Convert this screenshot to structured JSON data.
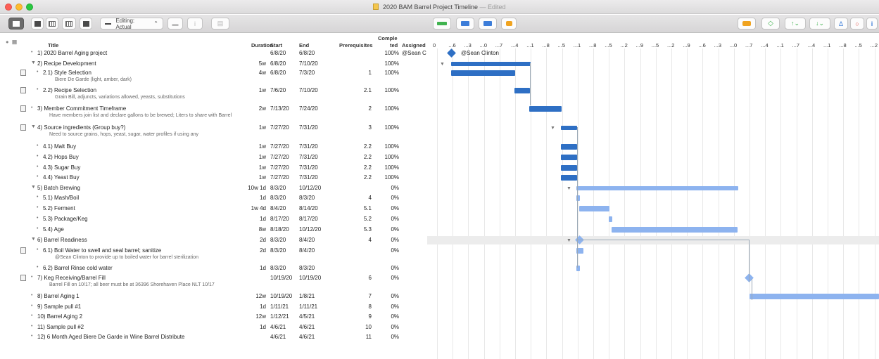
{
  "window": {
    "title": "2020 BAM Barrel Project Timeline",
    "status": "— Edited"
  },
  "toolbar": {
    "editing_label": "Editing: Actual",
    "editing_chevron": "⌃"
  },
  "columns": {
    "title": "Title",
    "duration": "Duration",
    "start": "Start",
    "end": "End",
    "prereq": "Prerequisites",
    "completed_1": "Comple",
    "completed_2": "ted",
    "assigned": "Assigned"
  },
  "gantt_header": [
    "0",
    "...6",
    "...3",
    "...0",
    "...7",
    "...4",
    "...1",
    "...8",
    "...5",
    "...1",
    "...8",
    "...5",
    "...2",
    "...9",
    "...5",
    "...2",
    "...9",
    "...6",
    "...3",
    "...0",
    "...7",
    "...4",
    "...1",
    "...7",
    "...4",
    "...1",
    "...8",
    "...5",
    "...2"
  ],
  "rows": [
    {
      "bullet": "•",
      "title": "1) 2020 Barrel Aging project",
      "duration": "",
      "start": "6/8/20",
      "end": "6/8/20",
      "prereq": "",
      "pct": "100%",
      "assigned": "@Sean C",
      "note": ""
    },
    {
      "bullet": "▼",
      "title": "2) Recipe Development",
      "duration": "5w",
      "start": "6/8/20",
      "end": "7/10/20",
      "prereq": "",
      "pct": "100%",
      "assigned": "",
      "note": ""
    },
    {
      "bullet": "•",
      "title": "2.1) Style Selection",
      "duration": "4w",
      "start": "6/8/20",
      "end": "7/3/20",
      "prereq": "1",
      "pct": "100%",
      "assigned": "",
      "note": "Biere De Garde (light, amber, dark)"
    },
    {
      "bullet": "•",
      "title": "2.2) Recipe Selection",
      "duration": "1w",
      "start": "7/6/20",
      "end": "7/10/20",
      "prereq": "2.1",
      "pct": "100%",
      "assigned": "",
      "note": "Grain Bill, adjuncts, variations allowed, yeasts, substitutions"
    },
    {
      "bullet": "•",
      "title": "3) Member Commitment Timeframe",
      "duration": "2w",
      "start": "7/13/20",
      "end": "7/24/20",
      "prereq": "2",
      "pct": "100%",
      "assigned": "",
      "note": "Have members join list and declare gallons to be brewed; Liters to share with Barrel"
    },
    {
      "bullet": "▼",
      "title": "4) Source ingredients (Group buy?)",
      "duration": "1w",
      "start": "7/27/20",
      "end": "7/31/20",
      "prereq": "3",
      "pct": "100%",
      "assigned": "",
      "note": "Need to source grains, hops, yeast, sugar, water profiles if using any"
    },
    {
      "bullet": "•",
      "title": "4.1) Malt Buy",
      "duration": "1w",
      "start": "7/27/20",
      "end": "7/31/20",
      "prereq": "2.2",
      "pct": "100%",
      "assigned": "",
      "note": ""
    },
    {
      "bullet": "•",
      "title": "4.2) Hops Buy",
      "duration": "1w",
      "start": "7/27/20",
      "end": "7/31/20",
      "prereq": "2.2",
      "pct": "100%",
      "assigned": "",
      "note": ""
    },
    {
      "bullet": "•",
      "title": "4.3) Sugar Buy",
      "duration": "1w",
      "start": "7/27/20",
      "end": "7/31/20",
      "prereq": "2.2",
      "pct": "100%",
      "assigned": "",
      "note": ""
    },
    {
      "bullet": "•",
      "title": "4.4) Yeast Buy",
      "duration": "1w",
      "start": "7/27/20",
      "end": "7/31/20",
      "prereq": "2.2",
      "pct": "100%",
      "assigned": "",
      "note": ""
    },
    {
      "bullet": "▼",
      "title": "5) Batch Brewing",
      "duration": "10w 1d",
      "start": "8/3/20",
      "end": "10/12/20",
      "prereq": "",
      "pct": "0%",
      "assigned": "",
      "note": ""
    },
    {
      "bullet": "•",
      "title": "5.1) Mash/Boil",
      "duration": "1d",
      "start": "8/3/20",
      "end": "8/3/20",
      "prereq": "4",
      "pct": "0%",
      "assigned": "",
      "note": ""
    },
    {
      "bullet": "•",
      "title": "5.2) Ferment",
      "duration": "1w 4d",
      "start": "8/4/20",
      "end": "8/14/20",
      "prereq": "5.1",
      "pct": "0%",
      "assigned": "",
      "note": ""
    },
    {
      "bullet": "•",
      "title": "5.3) Package/Keg",
      "duration": "1d",
      "start": "8/17/20",
      "end": "8/17/20",
      "prereq": "5.2",
      "pct": "0%",
      "assigned": "",
      "note": ""
    },
    {
      "bullet": "•",
      "title": "5.4) Age",
      "duration": "8w",
      "start": "8/18/20",
      "end": "10/12/20",
      "prereq": "5.3",
      "pct": "0%",
      "assigned": "",
      "note": ""
    },
    {
      "bullet": "▼",
      "title": "6) Barrel Readiness",
      "duration": "2d",
      "start": "8/3/20",
      "end": "8/4/20",
      "prereq": "4",
      "pct": "0%",
      "assigned": "",
      "note": ""
    },
    {
      "bullet": "•",
      "title": "6.1) Boil Water to swell and seal barrel; sanitize",
      "duration": "2d",
      "start": "8/3/20",
      "end": "8/4/20",
      "prereq": "",
      "pct": "0%",
      "assigned": "",
      "note": "@Sean Clinton to provide up to boiled water for barrel sterilization"
    },
    {
      "bullet": "•",
      "title": "6.2) Barrel Rinse cold water",
      "duration": "1d",
      "start": "8/3/20",
      "end": "8/3/20",
      "prereq": "",
      "pct": "0%",
      "assigned": "",
      "note": ""
    },
    {
      "bullet": "•",
      "title": "7) Keg Receiving/Barrel Fill",
      "duration": "",
      "start": "10/19/20",
      "end": "10/19/20",
      "prereq": "6",
      "pct": "0%",
      "assigned": "",
      "note": "Barrel Fill on 10/17; all beer must be at 36396 Shorehaven Place NLT 10/17"
    },
    {
      "bullet": "•",
      "title": "8) Barrel Aging 1",
      "duration": "12w",
      "start": "10/19/20",
      "end": "1/8/21",
      "prereq": "7",
      "pct": "0%",
      "assigned": "",
      "note": ""
    },
    {
      "bullet": "•",
      "title": "9) Sample pull #1",
      "duration": "1d",
      "start": "1/11/21",
      "end": "1/11/21",
      "prereq": "8",
      "pct": "0%",
      "assigned": "",
      "note": ""
    },
    {
      "bullet": "•",
      "title": "10) Barrel Aging 2",
      "duration": "12w",
      "start": "1/12/21",
      "end": "4/5/21",
      "prereq": "9",
      "pct": "0%",
      "assigned": "",
      "note": ""
    },
    {
      "bullet": "•",
      "title": "11) Sample pull #2",
      "duration": "1d",
      "start": "4/6/21",
      "end": "4/6/21",
      "prereq": "10",
      "pct": "0%",
      "assigned": "",
      "note": ""
    },
    {
      "bullet": "•",
      "title": "12) 6 Month Aged Biere De Garde in Wine Barrel Distribute",
      "duration": "",
      "start": "4/6/21",
      "end": "4/6/21",
      "prereq": "11",
      "pct": "0%",
      "assigned": "",
      "note": ""
    }
  ],
  "gantt_labels": {
    "milestone_1": "@Sean Clinton"
  }
}
